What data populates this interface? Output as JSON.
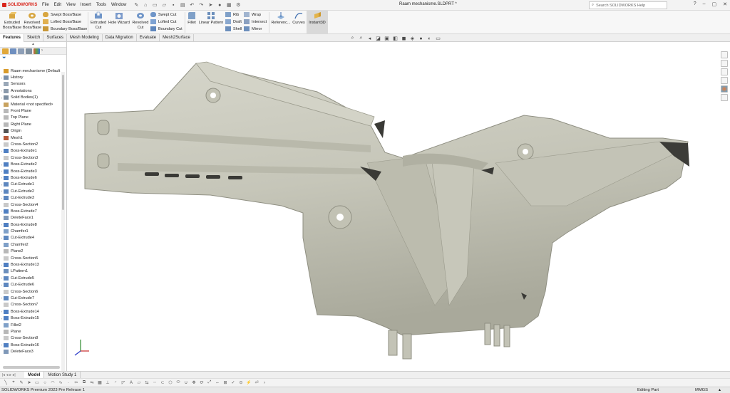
{
  "app": {
    "logo_text": "SOLIDWORKS",
    "document_title": "Raam mechanisme.SLDPRT *",
    "menus": [
      "File",
      "Edit",
      "View",
      "Insert",
      "Tools",
      "Window"
    ],
    "search_placeholder": "Search SOLIDWORKS Help",
    "brand_color": "#d9261c"
  },
  "ribbon": {
    "extruded_boss": "Extruded Boss/Base",
    "revolved_boss": "Revolved Boss/Base",
    "swept_boss": "Swept Boss/Base",
    "lofted_boss": "Lofted Boss/Base",
    "boundary_boss": "Boundary Boss/Base",
    "extruded_cut": "Extruded Cut",
    "hole_wizard": "Hole Wizard",
    "revolved_cut": "Revolved Cut",
    "swept_cut": "Swept Cut",
    "lofted_cut": "Lofted Cut",
    "boundary_cut": "Boundary Cut",
    "fillet": "Fillet",
    "linear_pattern": "Linear Pattern",
    "rib": "Rib",
    "draft": "Draft",
    "shell": "Shell",
    "wrap": "Wrap",
    "intersect": "Intersect",
    "mirror": "Mirror",
    "reference": "Referenc...",
    "curves": "Curves",
    "instant3d": "Instant3D"
  },
  "tabs": [
    {
      "label": "Features",
      "active": true
    },
    {
      "label": "Sketch",
      "active": false
    },
    {
      "label": "Surfaces",
      "active": false
    },
    {
      "label": "Mesh Modeling",
      "active": false
    },
    {
      "label": "Data Migration",
      "active": false
    },
    {
      "label": "Evaluate",
      "active": false
    },
    {
      "label": "Mesh2Surface",
      "active": false
    }
  ],
  "tree": [
    {
      "label": "Raam mechanisme  (Default",
      "icon": "part-icon",
      "color": "#d89b2b",
      "expander": ""
    },
    {
      "label": "History",
      "icon": "history-icon",
      "color": "#7a8fa8",
      "expander": "›"
    },
    {
      "label": "Sensors",
      "icon": "sensors-icon",
      "color": "#9aa8b8",
      "expander": ""
    },
    {
      "label": "Annotations",
      "icon": "annotations-icon",
      "color": "#8a99aa",
      "expander": "›"
    },
    {
      "label": "Solid Bodies(1)",
      "icon": "solid-bodies-icon",
      "color": "#7b8da0",
      "expander": "›"
    },
    {
      "label": "Material <not specified>",
      "icon": "material-icon",
      "color": "#c8a25e",
      "expander": ""
    },
    {
      "label": "Front Plane",
      "icon": "plane-icon",
      "color": "#b8b8b8",
      "expander": ""
    },
    {
      "label": "Top Plane",
      "icon": "plane-icon",
      "color": "#b8b8b8",
      "expander": ""
    },
    {
      "label": "Right Plane",
      "icon": "plane-icon",
      "color": "#b8b8b8",
      "expander": ""
    },
    {
      "label": "Origin",
      "icon": "origin-icon",
      "color": "#555555",
      "expander": ""
    },
    {
      "label": "Mesh1",
      "icon": "mesh-icon",
      "color": "#b85a3a",
      "expander": ""
    },
    {
      "label": "Cross-Section2",
      "icon": "cross-section-icon",
      "color": "#c9c9c9",
      "expander": ""
    },
    {
      "label": "Boss-Extrude1",
      "icon": "boss-extrude-icon",
      "color": "#4f7fc2",
      "expander": "›"
    },
    {
      "label": "Cross-Section3",
      "icon": "cross-section-icon",
      "color": "#c9c9c9",
      "expander": ""
    },
    {
      "label": "Boss-Extrude2",
      "icon": "boss-extrude-icon",
      "color": "#4f7fc2",
      "expander": "›"
    },
    {
      "label": "Boss-Extrude3",
      "icon": "boss-extrude-icon",
      "color": "#4f7fc2",
      "expander": "›"
    },
    {
      "label": "Boss-Extrude6",
      "icon": "boss-extrude-icon",
      "color": "#4f7fc2",
      "expander": "›"
    },
    {
      "label": "Cut-Extrude1",
      "icon": "cut-extrude-icon",
      "color": "#5d87bf",
      "expander": "›"
    },
    {
      "label": "Cut-Extrude2",
      "icon": "cut-extrude-icon",
      "color": "#5d87bf",
      "expander": "›"
    },
    {
      "label": "Cut-Extrude3",
      "icon": "cut-extrude-icon",
      "color": "#5d87bf",
      "expander": "›"
    },
    {
      "label": "Cross-Section4",
      "icon": "cross-section-icon",
      "color": "#c9c9c9",
      "expander": ""
    },
    {
      "label": "Boss-Extrude7",
      "icon": "boss-extrude-icon",
      "color": "#4f7fc2",
      "expander": "›"
    },
    {
      "label": "DeleteFace1",
      "icon": "delete-face-icon",
      "color": "#7f98b8",
      "expander": ""
    },
    {
      "label": "Boss-Extrude8",
      "icon": "boss-extrude-icon",
      "color": "#4f7fc2",
      "expander": "›"
    },
    {
      "label": "Chamfer1",
      "icon": "chamfer-icon",
      "color": "#7fa0c8",
      "expander": ""
    },
    {
      "label": "Cut-Extrude4",
      "icon": "cut-extrude-icon",
      "color": "#5d87bf",
      "expander": "›"
    },
    {
      "label": "Chamfer2",
      "icon": "chamfer-icon",
      "color": "#7fa0c8",
      "expander": ""
    },
    {
      "label": "Plane2",
      "icon": "plane-icon",
      "color": "#b8b8b8",
      "expander": ""
    },
    {
      "label": "Cross-Section5",
      "icon": "cross-section-icon",
      "color": "#c9c9c9",
      "expander": ""
    },
    {
      "label": "Boss-Extrude13",
      "icon": "boss-extrude-icon",
      "color": "#4f7fc2",
      "expander": "›"
    },
    {
      "label": "LPattern1",
      "icon": "linear-pattern-icon",
      "color": "#6c8fbc",
      "expander": ""
    },
    {
      "label": "Cut-Extrude5",
      "icon": "cut-extrude-icon",
      "color": "#5d87bf",
      "expander": "›"
    },
    {
      "label": "Cut-Extrude6",
      "icon": "cut-extrude-icon",
      "color": "#5d87bf",
      "expander": "›"
    },
    {
      "label": "Cross-Section6",
      "icon": "cross-section-icon",
      "color": "#c9c9c9",
      "expander": ""
    },
    {
      "label": "Cut-Extrude7",
      "icon": "cut-extrude-icon",
      "color": "#5d87bf",
      "expander": "›"
    },
    {
      "label": "Cross-Section7",
      "icon": "cross-section-icon",
      "color": "#c9c9c9",
      "expander": ""
    },
    {
      "label": "Boss-Extrude14",
      "icon": "boss-extrude-icon",
      "color": "#4f7fc2",
      "expander": "›"
    },
    {
      "label": "Boss-Extrude15",
      "icon": "boss-extrude-icon",
      "color": "#4f7fc2",
      "expander": "›"
    },
    {
      "label": "Fillet2",
      "icon": "fillet-icon",
      "color": "#7fa0c8",
      "expander": ""
    },
    {
      "label": "Plane",
      "icon": "plane-icon",
      "color": "#b8b8b8",
      "expander": ""
    },
    {
      "label": "Cross-Section8",
      "icon": "cross-section-icon",
      "color": "#c9c9c9",
      "expander": ""
    },
    {
      "label": "Boss-Extrude16",
      "icon": "boss-extrude-icon",
      "color": "#4f7fc2",
      "expander": "›"
    },
    {
      "label": "DeleteFace3",
      "icon": "delete-face-icon",
      "color": "#7f98b8",
      "expander": ""
    }
  ],
  "bottom_tabs": [
    {
      "label": "Model",
      "active": true
    },
    {
      "label": "Motion Study 1",
      "active": false
    }
  ],
  "status": {
    "app_version": "SOLIDWORKS Premium 2023 Pre Release 1",
    "mode": "Editing Part",
    "units": "MMGS",
    "units_arrow": "▴"
  },
  "viewport": {
    "background": "#ffffff",
    "part_color": "#c9c9bd",
    "part_shadow": "#8f8f82"
  }
}
